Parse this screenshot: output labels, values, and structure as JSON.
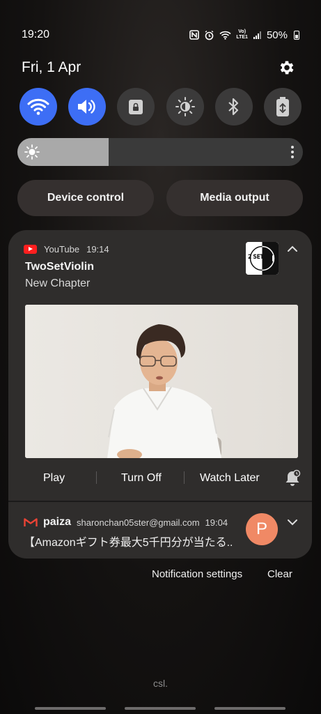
{
  "status_bar": {
    "time": "19:20",
    "battery": "50%",
    "network": "Vo)\nLTE1"
  },
  "header": {
    "date": "Fri, 1 Apr"
  },
  "quick_settings": {
    "tiles": [
      {
        "icon": "wifi-icon",
        "on": true
      },
      {
        "icon": "sound-icon",
        "on": true
      },
      {
        "icon": "lock-rotation-icon",
        "on": false
      },
      {
        "icon": "eye-comfort-icon",
        "on": false
      },
      {
        "icon": "bluetooth-icon",
        "on": false
      },
      {
        "icon": "power-saving-icon",
        "on": false
      }
    ],
    "brightness_level": 0.32
  },
  "buttons": {
    "device_control": "Device control",
    "media_output": "Media output"
  },
  "youtube_notification": {
    "app": "YouTube",
    "time": "19:14",
    "title": "TwoSetViolin",
    "text": "New Chapter",
    "avatar_text": "2 SET",
    "actions": {
      "play": "Play",
      "turn_off": "Turn Off",
      "watch_later": "Watch Later"
    }
  },
  "gmail_notification": {
    "app": "paiza",
    "account": "sharonchan05ster@gmail.com",
    "time": "19:04",
    "preview": "【Amazonギフト券最大5千円分が当たる..",
    "avatar_letter": "P"
  },
  "footer": {
    "notification_settings": "Notification settings",
    "clear": "Clear",
    "carrier": "csl."
  },
  "colors": {
    "accent": "#3d6ef5",
    "card": "#2f2d2c",
    "avatar_orange": "#f08965",
    "youtube_red": "#ff1f1f"
  }
}
